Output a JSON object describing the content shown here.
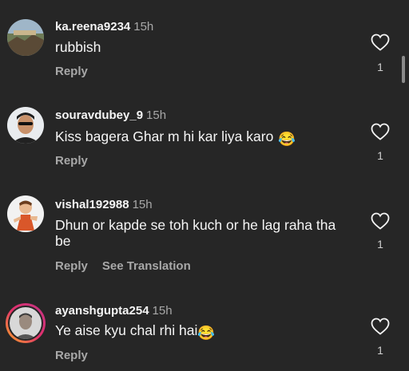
{
  "comments": [
    {
      "username": "ka.reena9234",
      "time": "15h",
      "text": "rubbish",
      "emoji": "",
      "reply": "Reply",
      "translate": "",
      "likes": "1"
    },
    {
      "username": "souravdubey_9",
      "time": "15h",
      "text": "Kiss bagera Ghar m hi kar liya karo",
      "emoji": "😂",
      "reply": "Reply",
      "translate": "",
      "likes": "1"
    },
    {
      "username": "vishal192988",
      "time": "15h",
      "text": "Dhun or kapde se toh kuch or he lag raha tha be",
      "emoji": "",
      "reply": "Reply",
      "translate": "See Translation",
      "likes": "1"
    },
    {
      "username": "ayanshgupta254",
      "time": "15h",
      "text": "Ye aise kyu chal rhi hai",
      "emoji": "😂",
      "reply": "Reply",
      "translate": "",
      "likes": "1"
    }
  ]
}
